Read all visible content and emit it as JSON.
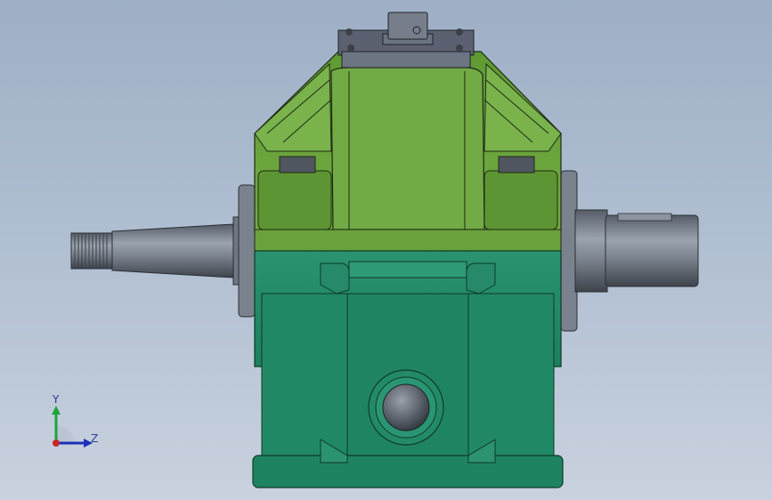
{
  "viewport": {
    "background_top": "#9eafc6",
    "background_bottom": "#c9d2de"
  },
  "model": {
    "upper_housing_color": "#6aa13c",
    "lower_housing_color": "#228a66",
    "shaft_color": "#7d8794",
    "cover_plate_color": "#5b6170"
  },
  "triad": {
    "y_label": "Y",
    "z_label": "Z",
    "y_color": "#1fa33a",
    "z_color": "#1c2fb8"
  }
}
